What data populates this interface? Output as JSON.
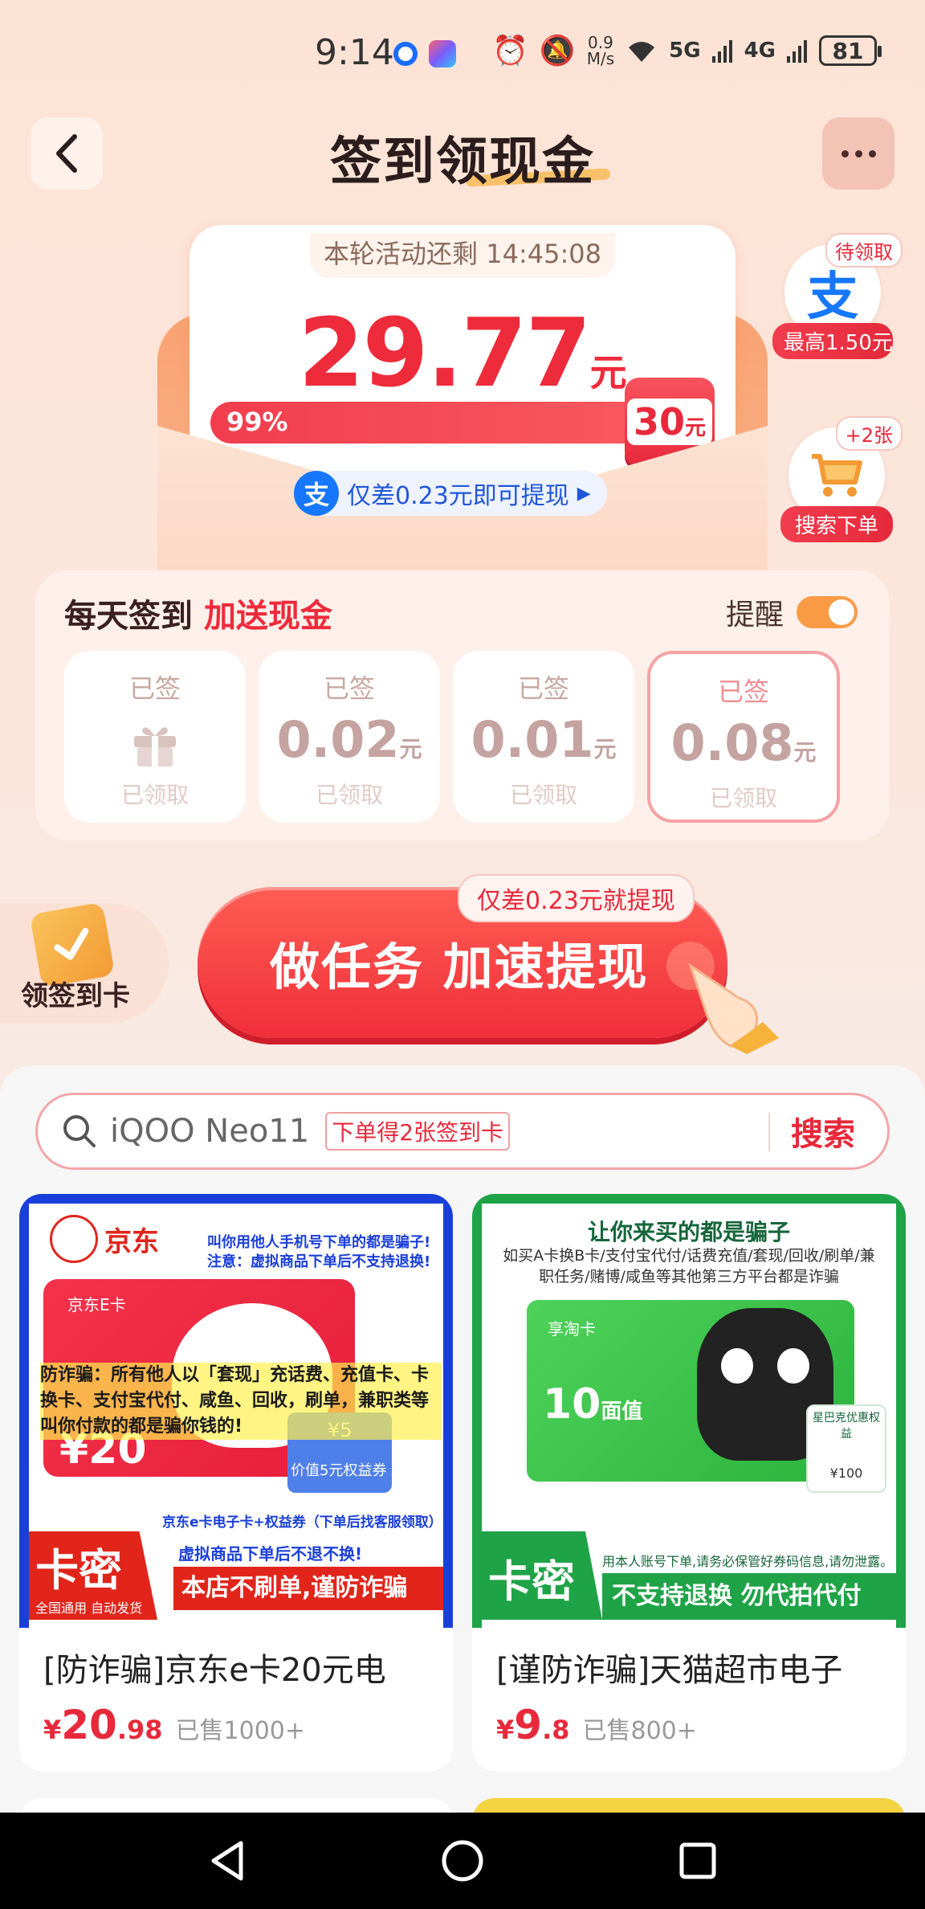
{
  "status_bar": {
    "time": "9:14",
    "speed": "0.9",
    "speed_unit": "M/s",
    "net1": "5G",
    "net2": "4G",
    "battery": "81"
  },
  "header": {
    "title": "签到领现金"
  },
  "envelope": {
    "countdown": "本轮活动还剩 14:45:08",
    "amount": "29.77",
    "unit": "元",
    "progress_text": "99%",
    "progress": 0.99,
    "target_amount": "30",
    "target_unit": "元",
    "need_text": "仅差0.23元即可提现",
    "need_icon": "支"
  },
  "floaters": {
    "alipay": {
      "tag": "待领取",
      "icon": "支",
      "label": "最高1.50元"
    },
    "cart": {
      "tag": "+2张",
      "label": "搜索下单"
    }
  },
  "checkin": {
    "title_prefix": "每天签到",
    "title_highlight": "加送现金",
    "remind_label": "提醒",
    "remind_on": true,
    "days": [
      {
        "signed": "已签",
        "amount": "",
        "unit": "",
        "status": "已领取",
        "gift": true
      },
      {
        "signed": "已签",
        "amount": "0.02",
        "unit": "元",
        "status": "已领取"
      },
      {
        "signed": "已签",
        "amount": "0.01",
        "unit": "元",
        "status": "已领取"
      },
      {
        "signed": "已签",
        "amount": "0.08",
        "unit": "元",
        "status": "已领取"
      }
    ]
  },
  "task": {
    "card_label": "领签到卡",
    "button_label": "做任务 加速提现",
    "tip": "仅差0.23元就提现"
  },
  "search": {
    "value": "iQOO Neo11",
    "tag": "下单得2张签到卡",
    "button": "搜索"
  },
  "products": [
    {
      "title": "[防诈骗]京东e卡20元电",
      "price_symbol": "¥",
      "price_int": "20",
      "price_dec": ".98",
      "sold": "已售1000+",
      "img": {
        "brand": "京东",
        "warn1": "叫你用他人手机号下单的都是骗子!",
        "warn2": "注意：虚拟商品下单后不支持退换!",
        "card_name": "京东E卡",
        "card_value": "¥20",
        "coupon": "¥5",
        "fraud_text": "防诈骗：所有他人以「套现」充话费、充值卡、卡换卡、支付宝代付、咸鱼、回收，刷单，兼职类等叫你付款的都是骗你钱的!",
        "benefit": "价值5元权益券",
        "subtitle": "京东e卡电子卡+权益券（下单后找客服领取）",
        "kami": "卡密",
        "kami_sub": "全国通用  自动发货",
        "no_refund": "虚拟商品下单后不退不换!",
        "no_brush": "本店不刷单,谨防诈骗"
      }
    },
    {
      "title": "[谨防诈骗]天猫超市电子",
      "price_symbol": "¥",
      "price_int": "9",
      "price_dec": ".8",
      "sold": "已售800+",
      "img": {
        "headline": "让你来买的都是骗子",
        "desc": "如买A卡换B卡/支付宝代付/话费充值/套现/回收/刷单/兼职任务/赌博/咸鱼等其他第三方平台都是诈骗",
        "card_name": "享淘卡",
        "card_value": "10",
        "card_value_unit": "面值",
        "starbucks": "星巴克优惠权益",
        "starbucks_price": "¥100",
        "kami": "卡密",
        "notice": "用本人账号下单,请务必保管好券码信息,请勿泄露。",
        "no_refund": "不支持退换  勿代拍代付"
      }
    }
  ],
  "colors": {
    "accent_red": "#ee2b3b",
    "jd_blue": "#1a3fd8",
    "tmall_green": "#1fa347"
  }
}
